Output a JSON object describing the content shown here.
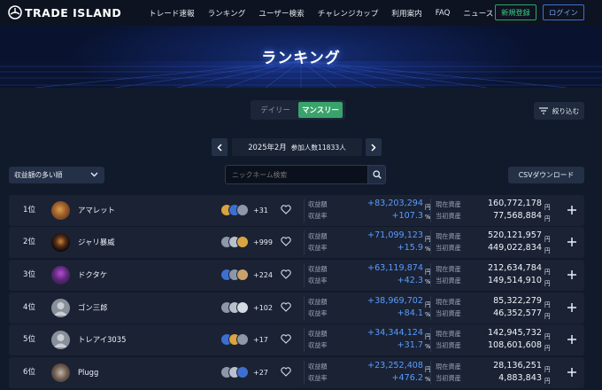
{
  "header": {
    "logo": "TRADE ISLAND",
    "nav": [
      "トレード速報",
      "ランキング",
      "ユーザー検索",
      "チャレンジカップ",
      "利用案内",
      "FAQ",
      "ニュース"
    ],
    "register_label": "新規登録",
    "login_label": "ログイン"
  },
  "hero": {
    "title": "ランキング"
  },
  "period_toggle": {
    "daily": "デイリー",
    "monthly": "マンスリー",
    "selected": "monthly"
  },
  "filter_button": "絞り込む",
  "month": {
    "label": "2025年2月",
    "participants": "参加人数11833人"
  },
  "sort": {
    "selected": "収益額の多い順"
  },
  "search": {
    "placeholder": "ニックネーム検索"
  },
  "csv_button": "CSVダウンロード",
  "labels": {
    "profit_amount": "収益額",
    "profit_rate": "収益率",
    "current_assets": "現在資産",
    "initial_assets": "当初資産",
    "yen": "円",
    "percent": "%"
  },
  "rows": [
    {
      "rank": "1位",
      "name": "アマレット",
      "followers": "+31",
      "profit": "+83,203,294",
      "rate": "+107.3",
      "current": "160,772,178",
      "initial": "77,568,884"
    },
    {
      "rank": "2位",
      "name": "ジャリ暴威",
      "followers": "+999",
      "profit": "+71,099,123",
      "rate": "+15.9",
      "current": "520,121,957",
      "initial": "449,022,834"
    },
    {
      "rank": "3位",
      "name": "ドクタケ",
      "followers": "+224",
      "profit": "+63,119,874",
      "rate": "+42.3",
      "current": "212,634,784",
      "initial": "149,514,910"
    },
    {
      "rank": "4位",
      "name": "ゴン三郎",
      "followers": "+102",
      "profit": "+38,969,702",
      "rate": "+84.1",
      "current": "85,322,279",
      "initial": "46,352,577"
    },
    {
      "rank": "5位",
      "name": "トレアイ3035",
      "followers": "+17",
      "profit": "+34,344,124",
      "rate": "+31.7",
      "current": "142,945,732",
      "initial": "108,601,608"
    },
    {
      "rank": "6位",
      "name": "Plugg",
      "followers": "+27",
      "profit": "+23,252,408",
      "rate": "+476.2",
      "current": "28,136,251",
      "initial": "4,883,843"
    }
  ],
  "colors": {
    "accent_green": "#3aa36c",
    "profit_blue": "#5a9cff",
    "background": "#111a2a"
  }
}
